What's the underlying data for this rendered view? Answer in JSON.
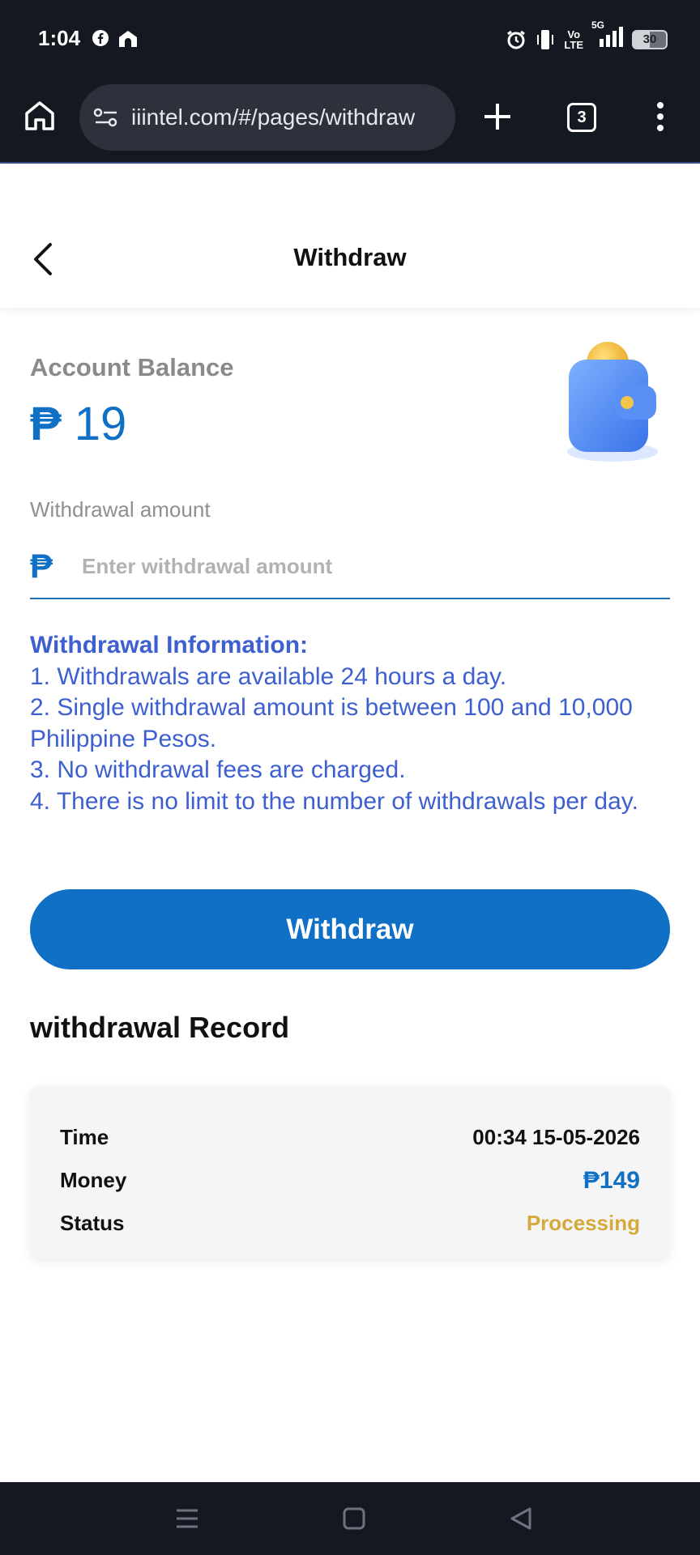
{
  "status_bar": {
    "time": "1:04",
    "left_icons": [
      "facebook-icon",
      "home-app-icon"
    ],
    "right_icons": [
      "alarm-icon",
      "vibrate-icon",
      "volte-icon",
      "5g-signal-icon"
    ],
    "volte_line1": "Vo",
    "volte_line2": "LTE",
    "network": "5G",
    "battery": "30"
  },
  "browser": {
    "url": "iiintel.com/#/pages/withdraw",
    "tab_count": "3"
  },
  "header": {
    "title": "Withdraw"
  },
  "balance": {
    "label": "Account Balance",
    "currency_symbol": "₱",
    "amount": "19"
  },
  "withdrawal": {
    "label": "Withdrawal amount",
    "currency_symbol": "₱",
    "placeholder": "Enter withdrawal amount",
    "value": ""
  },
  "info": {
    "title": "Withdrawal Information:",
    "lines": [
      "1. Withdrawals are available 24 hours a day.",
      "2. Single withdrawal amount is between 100 and 10,000 Philippine Pesos.",
      "3. No withdrawal fees are charged.",
      "4. There is no limit to the number of withdrawals per day."
    ]
  },
  "withdraw_button": {
    "label": "Withdraw"
  },
  "record": {
    "title": "withdrawal Record",
    "entries": [
      {
        "time_label": "Time",
        "time": "00:34 15-05-2026",
        "money_label": "Money",
        "money": "₱149",
        "status_label": "Status",
        "status": "Processing"
      }
    ]
  },
  "colors": {
    "accent": "#0f70c6",
    "info_text": "#3d5fcf",
    "status_processing": "#d4aa3c",
    "system_bar": "#141821"
  }
}
